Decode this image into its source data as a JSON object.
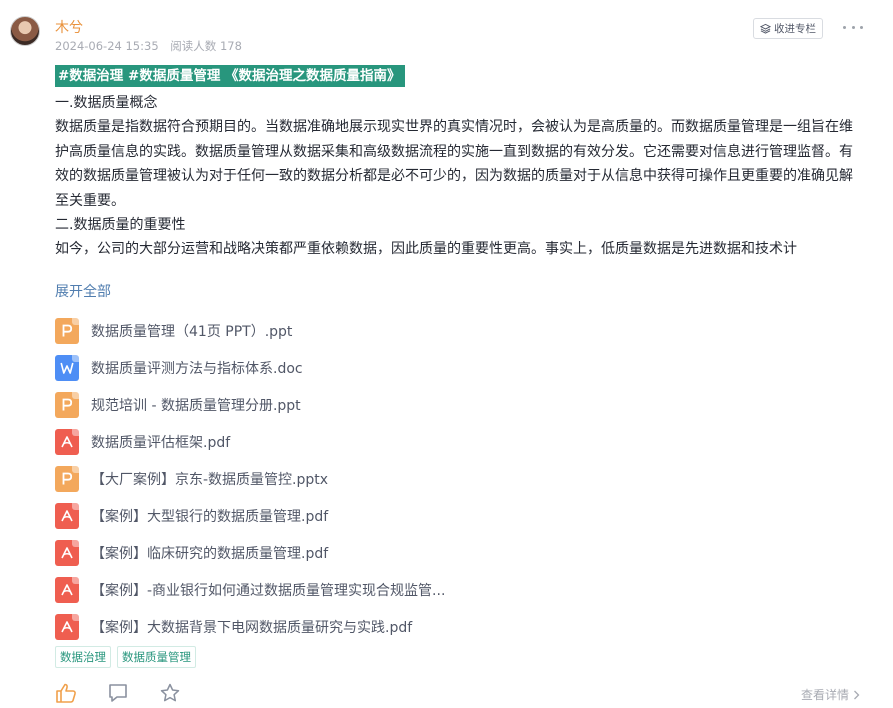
{
  "post": {
    "author": "木兮",
    "date": "2024-06-24 15:35",
    "reads": "阅读人数 178",
    "collect_label": "收进专栏",
    "tag_banner": "#数据治理  #数据质量管理  《数据治理之数据质量指南》",
    "paragraphs": [
      "一.数据质量概念",
      "数据质量是指数据符合预期目的。当数据准确地展示现实世界的真实情况时，会被认为是高质量的。而数据质量管理是一组旨在维护高质量信息的实践。数据质量管理从数据采集和高级数据流程的实施一直到数据的有效分发。它还需要对信息进行管理监督。有效的数据质量管理被认为对于任何一致的数据分析都是必不可少的，因为数据的质量对于从信息中获得可操作且更重要的准确见解至关重要。",
      "二.数据质量的重要性",
      "如今，公司的大部分运营和战略决策都严重依赖数据，因此质量的重要性更高。事实上，低质量数据是先进数据和技术计"
    ],
    "expand_label": "展开全部",
    "files": [
      {
        "type": "ppt",
        "icon": "ppt-file-icon",
        "name": "数据质量管理（41页 PPT）.ppt"
      },
      {
        "type": "doc",
        "icon": "word-file-icon",
        "name": "数据质量评测方法与指标体系.doc"
      },
      {
        "type": "ppt",
        "icon": "ppt-file-icon",
        "name": "规范培训 - 数据质量管理分册.ppt"
      },
      {
        "type": "pdf",
        "icon": "pdf-file-icon",
        "name": "数据质量评估框架.pdf"
      },
      {
        "type": "ppt",
        "icon": "ppt-file-icon",
        "name": "【大厂案例】京东-数据质量管控.pptx"
      },
      {
        "type": "pdf",
        "icon": "pdf-file-icon",
        "name": "【案例】大型银行的数据质量管理.pdf"
      },
      {
        "type": "pdf",
        "icon": "pdf-file-icon",
        "name": "【案例】临床研究的数据质量管理.pdf"
      },
      {
        "type": "pdf",
        "icon": "pdf-file-icon",
        "name": "【案例】-商业银行如何通过数据质量管理实现合规监管..."
      },
      {
        "type": "pdf",
        "icon": "pdf-file-icon",
        "name": "【案例】大数据背景下电网数据质量研究与实践.pdf"
      }
    ],
    "tags": [
      "数据治理",
      "数据质量管理"
    ],
    "detail_label": "查看详情"
  },
  "colors": {
    "author": "#e9913a",
    "banner": "#28967d",
    "link": "#507daf",
    "ppt": "#f3a85c",
    "doc": "#4e8ef5",
    "pdf": "#ef5e50"
  }
}
